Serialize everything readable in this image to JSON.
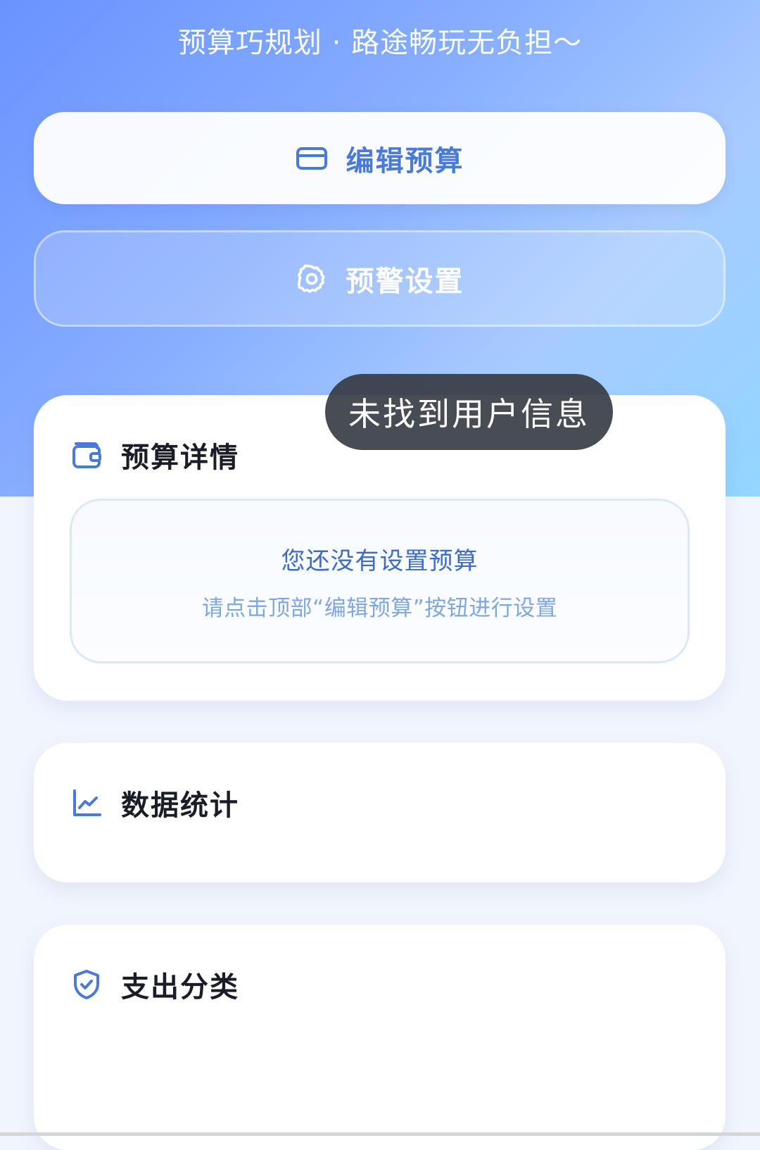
{
  "header": {
    "tagline": "预算巧规划 · 路途畅玩无负担～"
  },
  "actions": {
    "edit_budget_label": "编辑预算",
    "edit_budget_icon": "credit-card-icon",
    "alert_settings_label": "预警设置",
    "alert_settings_icon": "gear-icon"
  },
  "budget_details": {
    "title": "预算详情",
    "icon": "wallet-icon",
    "empty_title": "您还没有设置预算",
    "empty_hint": "请点击顶部“编辑预算”按钮进行设置"
  },
  "statistics": {
    "title": "数据统计",
    "icon": "line-chart-icon"
  },
  "expense_category": {
    "title": "支出分类",
    "icon": "shield-check-icon"
  },
  "toast": {
    "message": "未找到用户信息"
  },
  "colors": {
    "accent": "#4a7ad8",
    "gradient_start": "#6a93ff",
    "gradient_end": "#93d6ff",
    "toast_bg": "#343840"
  }
}
